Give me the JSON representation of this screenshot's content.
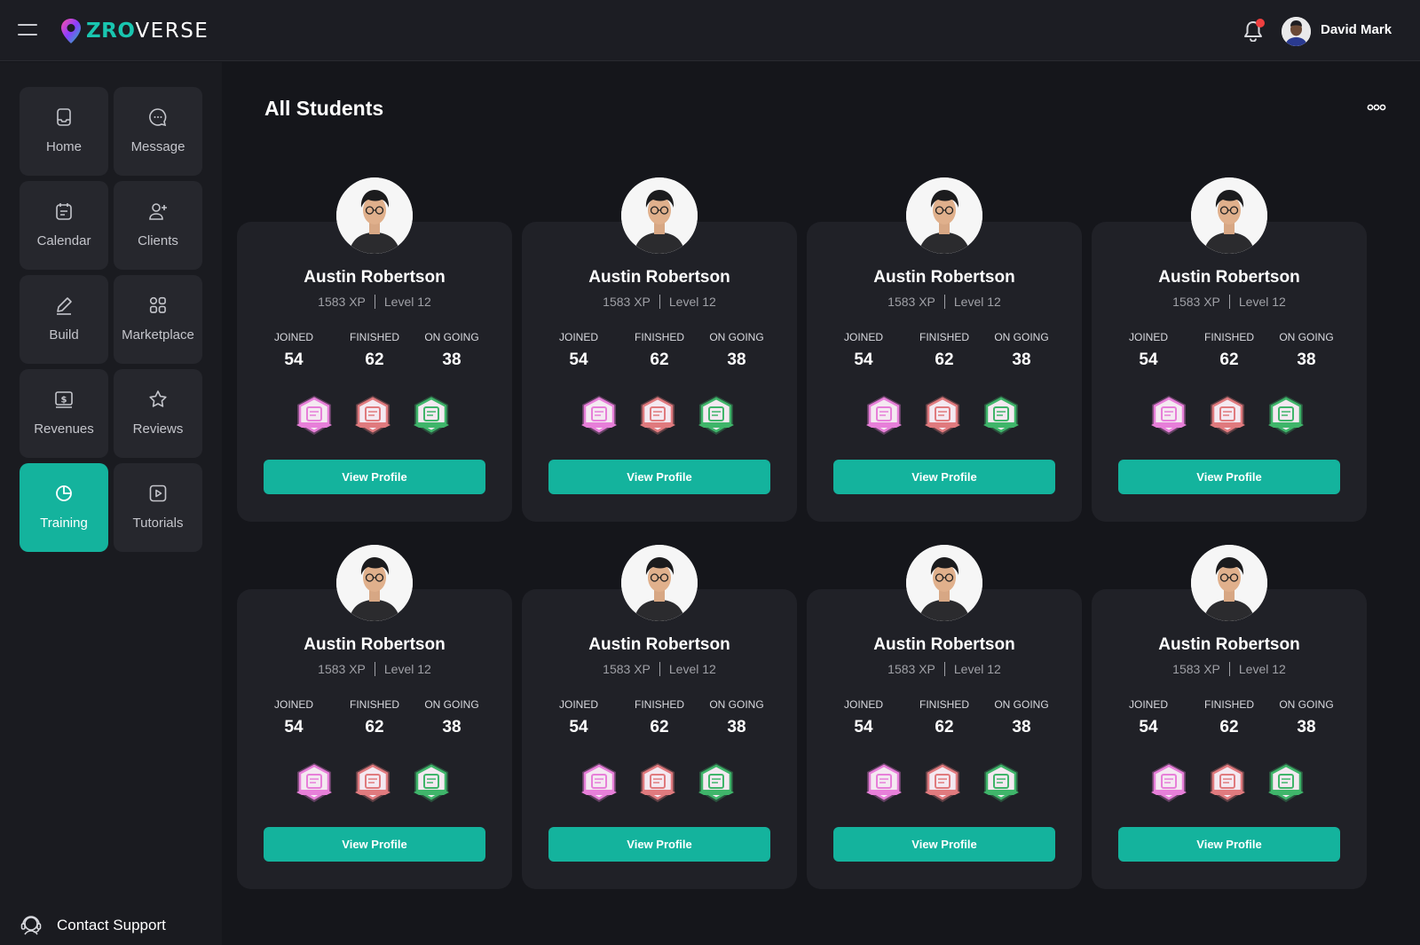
{
  "app": {
    "logo_zro": "ZRO",
    "logo_verse": "VERSE"
  },
  "user": {
    "name": "David Mark"
  },
  "sidebar": {
    "items": [
      {
        "label": "Home",
        "icon": "home-icon",
        "active": false
      },
      {
        "label": "Message",
        "icon": "message-icon",
        "active": false
      },
      {
        "label": "Calendar",
        "icon": "calendar-icon",
        "active": false
      },
      {
        "label": "Clients",
        "icon": "add-user-icon",
        "active": false
      },
      {
        "label": "Build",
        "icon": "pencil-icon",
        "active": false
      },
      {
        "label": "Marketplace",
        "icon": "grid-icon",
        "active": false
      },
      {
        "label": "Revenues",
        "icon": "dollar-icon",
        "active": false
      },
      {
        "label": "Reviews",
        "icon": "star-icon",
        "active": false
      },
      {
        "label": "Training",
        "icon": "pie-chart-icon",
        "active": true
      },
      {
        "label": "Tutorials",
        "icon": "play-icon",
        "active": false
      }
    ],
    "support_label": "Contact Support"
  },
  "main": {
    "title": "All Students",
    "stat_labels": {
      "joined": "JOINED",
      "finished": "FINISHED",
      "ongoing": "ON GOING"
    },
    "button_label": "View Profile",
    "students": [
      {
        "name": "Austin Robertson",
        "xp": "1583 XP",
        "level": "Level 12",
        "joined": "54",
        "finished": "62",
        "ongoing": "38"
      },
      {
        "name": "Austin Robertson",
        "xp": "1583 XP",
        "level": "Level 12",
        "joined": "54",
        "finished": "62",
        "ongoing": "38"
      },
      {
        "name": "Austin Robertson",
        "xp": "1583 XP",
        "level": "Level 12",
        "joined": "54",
        "finished": "62",
        "ongoing": "38"
      },
      {
        "name": "Austin Robertson",
        "xp": "1583 XP",
        "level": "Level 12",
        "joined": "54",
        "finished": "62",
        "ongoing": "38"
      },
      {
        "name": "Austin Robertson",
        "xp": "1583 XP",
        "level": "Level 12",
        "joined": "54",
        "finished": "62",
        "ongoing": "38"
      },
      {
        "name": "Austin Robertson",
        "xp": "1583 XP",
        "level": "Level 12",
        "joined": "54",
        "finished": "62",
        "ongoing": "38"
      },
      {
        "name": "Austin Robertson",
        "xp": "1583 XP",
        "level": "Level 12",
        "joined": "54",
        "finished": "62",
        "ongoing": "38"
      },
      {
        "name": "Austin Robertson",
        "xp": "1583 XP",
        "level": "Level 12",
        "joined": "54",
        "finished": "62",
        "ongoing": "38"
      }
    ],
    "badges": [
      {
        "icon": "qr-badge-icon",
        "color": "#e77fd9"
      },
      {
        "icon": "writing-badge-icon",
        "color": "#e07a7e"
      },
      {
        "icon": "testing-badge-icon",
        "color": "#3fb56a"
      }
    ]
  },
  "colors": {
    "accent": "#14b39d",
    "background": "#15161b",
    "card": "#202127",
    "notification": "#ef3f3f"
  }
}
